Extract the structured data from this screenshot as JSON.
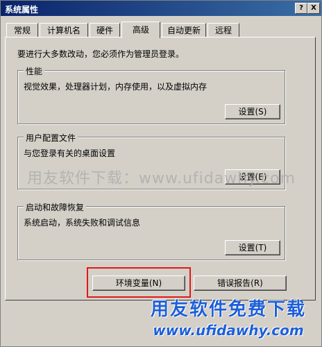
{
  "window": {
    "title": "系统属性",
    "help_button": "?",
    "close_button": "X"
  },
  "tabs": [
    {
      "label": "常规",
      "active": false
    },
    {
      "label": "计算机名",
      "active": false
    },
    {
      "label": "硬件",
      "active": false
    },
    {
      "label": "高级",
      "active": true
    },
    {
      "label": "自动更新",
      "active": false
    },
    {
      "label": "远程",
      "active": false
    }
  ],
  "notice": "要进行大多数改动，您必须作为管理员登录。",
  "groups": {
    "performance": {
      "title": "性能",
      "description": "视觉效果，处理器计划，内存使用，以及虚拟内存",
      "button": "设置(S)"
    },
    "user_profiles": {
      "title": "用户配置文件",
      "description": "与您登录有关的桌面设置",
      "button": "设置(E)"
    },
    "startup_recovery": {
      "title": "启动和故障恢复",
      "description": "系统启动，系统失败和调试信息",
      "button": "设置(T)"
    }
  },
  "bottom_buttons": {
    "env_vars": "环境变量(N)",
    "error_report": "错误报告(R)"
  },
  "watermark": "用友软件下载：www.ufidawhy.com",
  "brand": {
    "line1": "用友软件免费下载",
    "line2": "www.ufidawhy.com"
  },
  "colors": {
    "highlight_border": "#e01818",
    "brand_text": "#1e5fd8",
    "dialog_bg": "#d4d0c8"
  }
}
